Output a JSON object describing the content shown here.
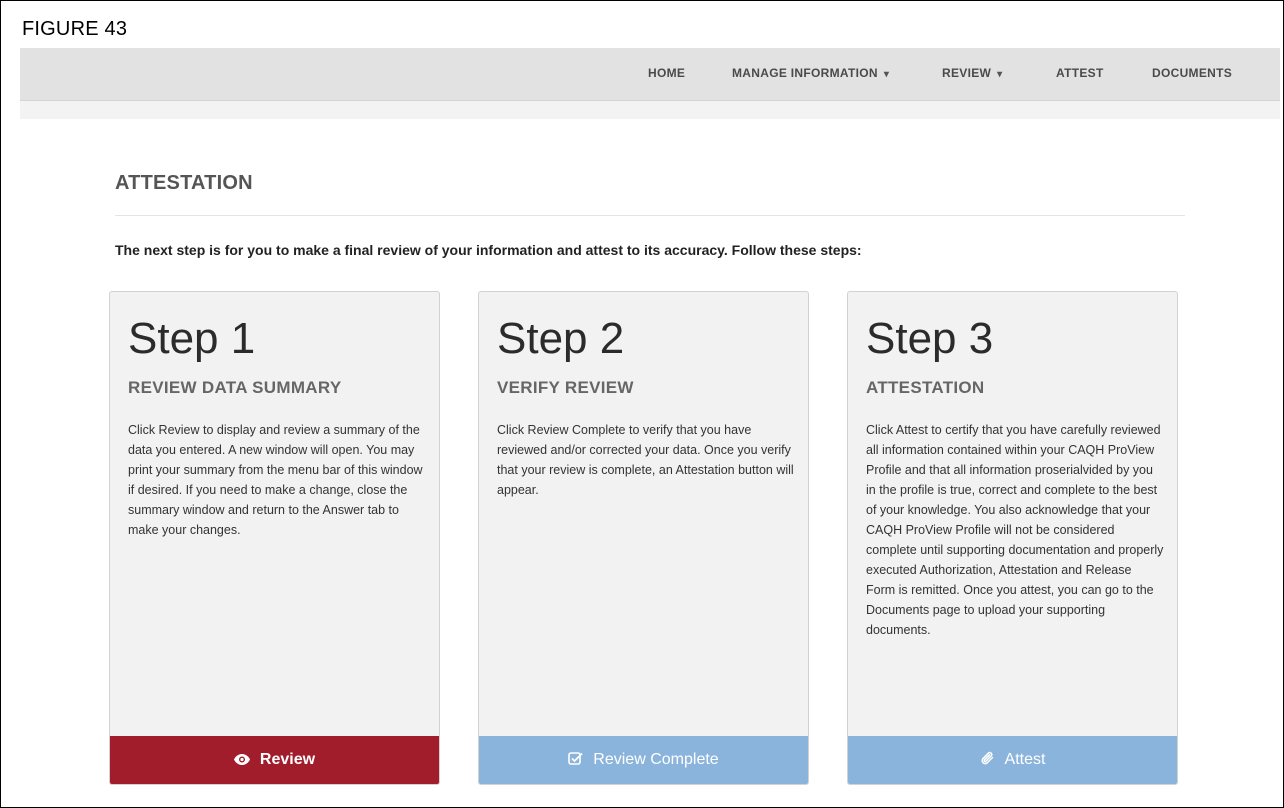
{
  "figure_label": "FIGURE 43",
  "nav": {
    "home": "HOME",
    "manage_information": "MANAGE INFORMATION",
    "review": "REVIEW",
    "attest": "ATTEST",
    "documents": "DOCUMENTS"
  },
  "page": {
    "title": "ATTESTATION",
    "intro": "The next step is for you to make a final review of your information and attest to its accuracy. Follow these steps:"
  },
  "steps": [
    {
      "heading": "Step 1",
      "subheading": "REVIEW DATA SUMMARY",
      "body": "Click Review to display and review a summary of the data you entered. A new window will open. You may print your summary from the menu bar of this window if desired. If you need to make a change, close the summary window and return to the Answer tab to make your changes.",
      "button_label": "Review",
      "button_icon": "eye-icon",
      "button_color": "#a11d2c"
    },
    {
      "heading": "Step 2",
      "subheading": "VERIFY REVIEW",
      "body": "Click Review Complete to verify that you have reviewed and/or corrected your data. Once you verify that your review is complete, an Attestation button will appear.",
      "button_label": "Review Complete",
      "button_icon": "check-square-icon",
      "button_color": "#8ab4dc"
    },
    {
      "heading": "Step 3",
      "subheading": "ATTESTATION",
      "body": "Click Attest to certify that you have carefully reviewed all information contained within your CAQH ProView Profile and that all information proserialvided by you in the profile is true, correct and complete to the best of your knowledge. You also acknowledge that your CAQH ProView Profile will not be considered complete until supporting documentation and properly executed Authorization, Attestation and Release Form is remitted. Once you attest, you can go to the Documents page to upload your supporting documents.",
      "button_label": "Attest",
      "button_icon": "paperclip-icon",
      "button_color": "#8ab4dc"
    }
  ]
}
